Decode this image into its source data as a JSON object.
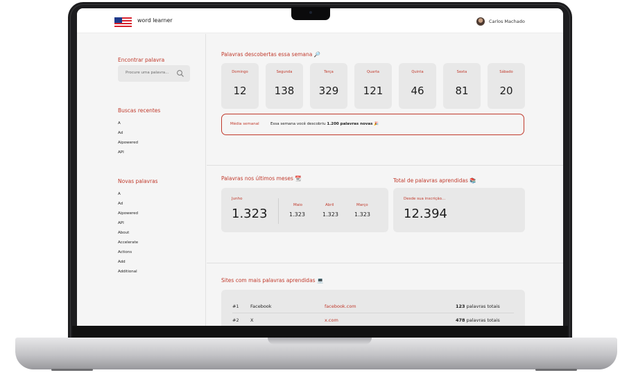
{
  "header": {
    "app_name": "word learner",
    "user_name": "Carlos Machado"
  },
  "sidebar": {
    "search_title": "Encontrar palavra",
    "search_placeholder": "Procure uma palavra...",
    "recent_title": "Buscas recentes",
    "recent_items": [
      "A",
      "Ad",
      "Aipowered",
      "API"
    ],
    "new_title": "Novas palavras",
    "new_items": [
      "A",
      "Ad",
      "Aipowered",
      "API",
      "About",
      "Accelerate",
      "Actions",
      "Add",
      "Additional"
    ]
  },
  "week": {
    "title": "Palavras descobertas essa semana",
    "title_icon": "🔎",
    "days": [
      {
        "name": "Domingo",
        "value": "12"
      },
      {
        "name": "Segunda",
        "value": "138"
      },
      {
        "name": "Terça",
        "value": "329"
      },
      {
        "name": "Quarta",
        "value": "121"
      },
      {
        "name": "Quinta",
        "value": "46"
      },
      {
        "name": "Sexta",
        "value": "81"
      },
      {
        "name": "Sábado",
        "value": "20"
      }
    ],
    "avg_label": "Média semanal",
    "avg_text_before": "Essa semana você descobriu ",
    "avg_text_bold": "1.200 palavras novas",
    "avg_icon": "🎉"
  },
  "months": {
    "title": "Palavras nos últimos meses",
    "title_icon": "📆",
    "current_label": "Junho",
    "current_value": "1.323",
    "previous": [
      {
        "name": "Maio",
        "value": "1.323"
      },
      {
        "name": "Abril",
        "value": "1.323"
      },
      {
        "name": "Março",
        "value": "1.323"
      }
    ]
  },
  "total": {
    "title": "Total de palavras aprendidas",
    "title_icon": "📚",
    "label": "Desde sua inscrição...",
    "value": "12.394"
  },
  "sites": {
    "title": "Sites com mais palavras aprendidas",
    "title_icon": "💻",
    "rows": [
      {
        "rank": "#1",
        "name": "Facebook",
        "url": "facebook.com",
        "count": "123",
        "suffix": " palavras totais"
      },
      {
        "rank": "#2",
        "name": "X",
        "url": "x.com",
        "count": "478",
        "suffix": " palavras totais"
      }
    ]
  }
}
